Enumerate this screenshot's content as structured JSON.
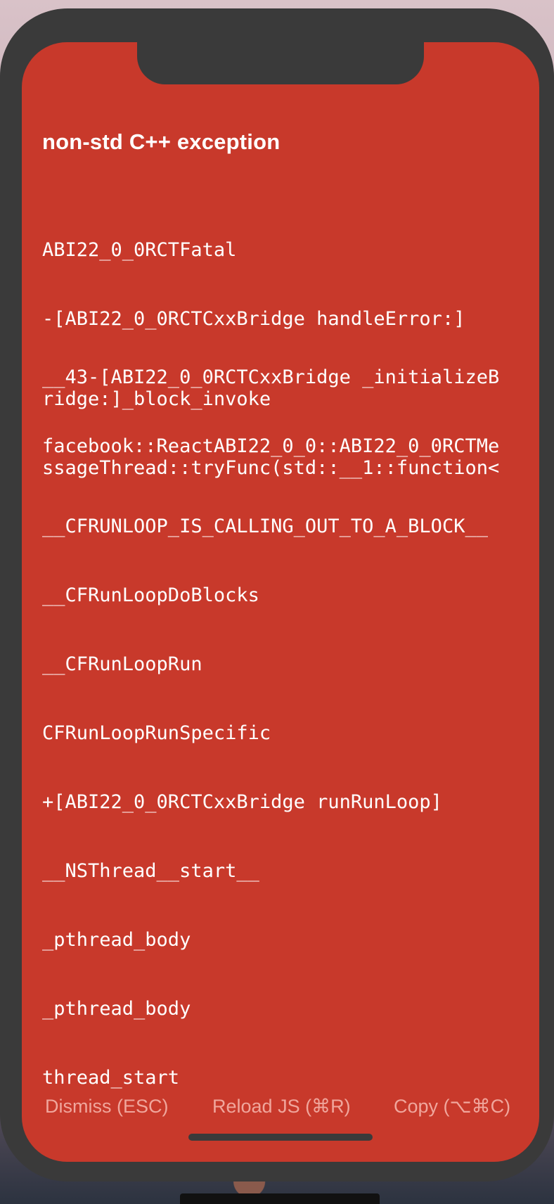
{
  "error": {
    "title": "non-std C++ exception",
    "frames": [
      "ABI22_0_0RCTFatal",
      "-[ABI22_0_0RCTCxxBridge handleError:]",
      "__43-[ABI22_0_0RCTCxxBridge _initializeB\nridge:]_block_invoke",
      "facebook::ReactABI22_0_0::ABI22_0_0RCTMe\nssageThread::tryFunc(std::__1::function<",
      "__CFRUNLOOP_IS_CALLING_OUT_TO_A_BLOCK__",
      "__CFRunLoopDoBlocks",
      "__CFRunLoopRun",
      "CFRunLoopRunSpecific",
      "+[ABI22_0_0RCTCxxBridge runRunLoop]",
      "__NSThread__start__",
      "_pthread_body",
      "_pthread_body",
      "thread_start"
    ]
  },
  "actions": {
    "dismiss": "Dismiss (ESC)",
    "reload": "Reload JS (⌘R)",
    "copy": "Copy (⌥⌘C)"
  },
  "colors": {
    "screen_background": "#c8392b",
    "device_frame": "#3a3a3a",
    "text": "#ffffff",
    "action_text": "#f0a69c"
  }
}
